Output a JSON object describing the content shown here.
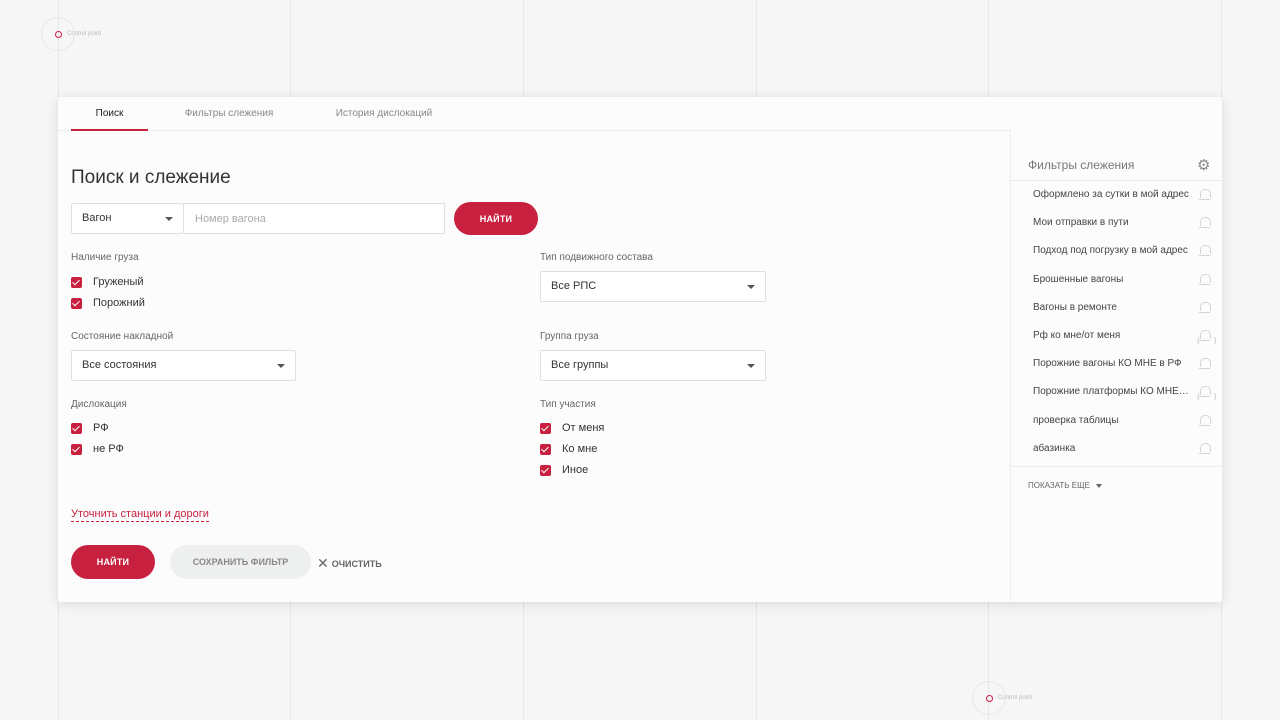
{
  "control_point_label": "Control point",
  "tabs": [
    {
      "label": "Поиск"
    },
    {
      "label": "Фильтры слежения"
    },
    {
      "label": "История дислокаций"
    }
  ],
  "title": "Поиск и слежение",
  "search": {
    "type_value": "Вагон",
    "placeholder": "Номер вагона",
    "find_label": "НАЙТИ"
  },
  "cargo": {
    "label": "Наличие груза",
    "options": [
      "Груженый",
      "Порожний"
    ]
  },
  "waybill": {
    "label": "Состояние накладной",
    "value": "Все состояния"
  },
  "dislocation": {
    "label": "Дислокация",
    "options": [
      "РФ",
      "не РФ"
    ]
  },
  "rolling_stock": {
    "label": "Тип подвижного состава",
    "value": "Все РПС"
  },
  "cargo_group": {
    "label": "Группа груза",
    "value": "Все группы"
  },
  "participation": {
    "label": "Тип участия",
    "options": [
      "От меня",
      "Ко мне",
      "Иное"
    ]
  },
  "refine_link": "Уточнить станции и дороги",
  "actions": {
    "find": "НАЙТИ",
    "save": "СОХРАНИТЬ ФИЛЬТР",
    "clear": "ОЧИСТИТЬ"
  },
  "sidebar": {
    "title": "Фильтры слежения",
    "items": [
      {
        "label": "Оформлено за сутки в мой адрес"
      },
      {
        "label": "Мои отправки в пути"
      },
      {
        "label": "Подход под погрузку в мой адрес"
      },
      {
        "label": "Брошенные вагоны"
      },
      {
        "label": "Вагоны в ремонте"
      },
      {
        "label": "Рф ко мне/от меня"
      },
      {
        "label": "Порожние вагоны КО МНЕ в РФ"
      },
      {
        "label": "Порожние платформы КО МНЕ на РФ"
      },
      {
        "label": "проверка таблицы"
      },
      {
        "label": "абазинка"
      }
    ],
    "show_more": "ПОКАЗАТЬ ЕЩЕ"
  },
  "colors": {
    "accent": "#c8203f",
    "background": "#f6f6f6"
  }
}
